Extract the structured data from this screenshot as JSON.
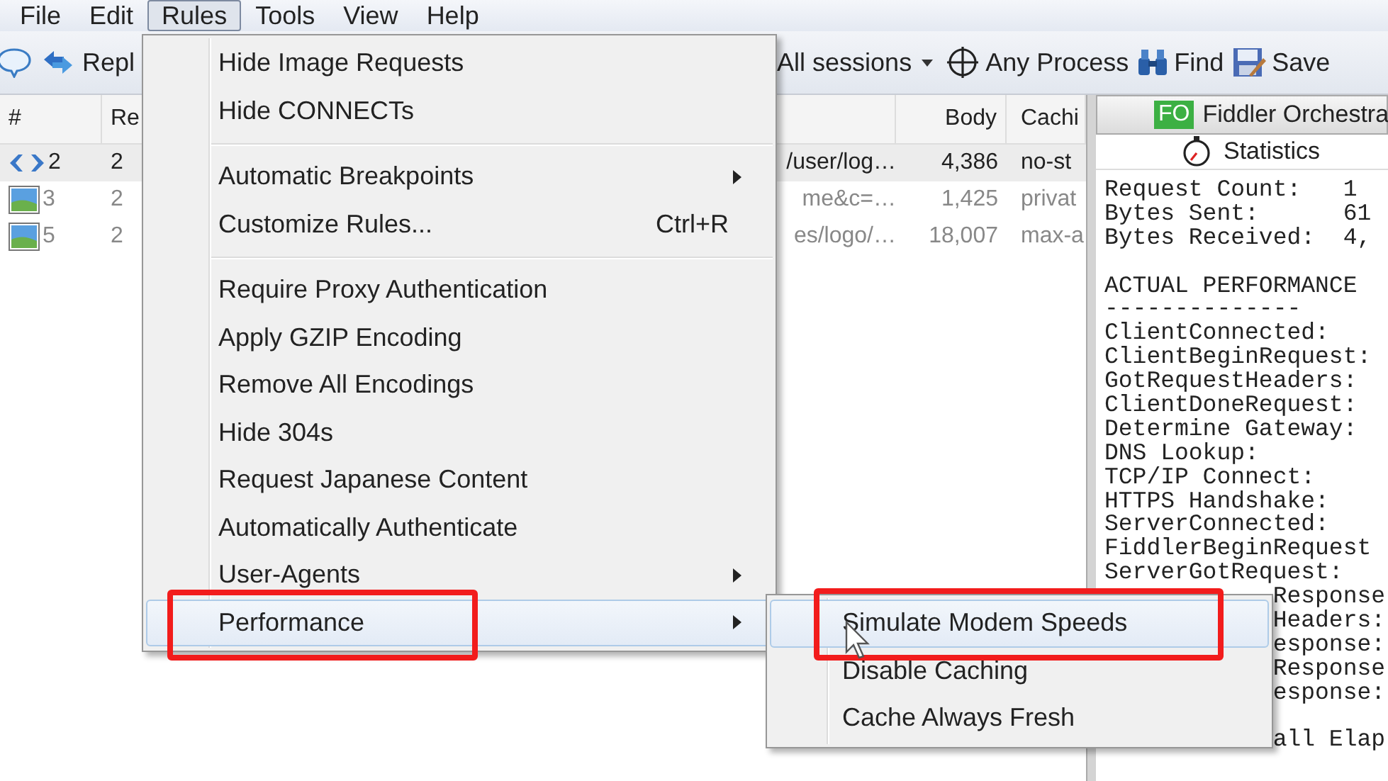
{
  "menubar": [
    {
      "label": "File",
      "selected": false
    },
    {
      "label": "Edit",
      "selected": false
    },
    {
      "label": "Rules",
      "selected": true
    },
    {
      "label": "Tools",
      "selected": false
    },
    {
      "label": "View",
      "selected": false
    },
    {
      "label": "Help",
      "selected": false
    }
  ],
  "toolbar": {
    "replay": "Repl",
    "sessions_filter": "All sessions",
    "process": "Any Process",
    "find": "Find",
    "save": "Save"
  },
  "sessions": {
    "columns": [
      "#",
      "Re",
      "Body",
      "Cachi"
    ],
    "rows": [
      {
        "kind": "code",
        "number": "2",
        "result": "2",
        "url": "/user/log…",
        "body": "4,386",
        "caching": "no-st",
        "selected": true
      },
      {
        "kind": "image",
        "number": "3",
        "result": "2",
        "url": "me&c=…",
        "body": "1,425",
        "caching": "privat",
        "selected": false
      },
      {
        "kind": "image",
        "number": "5",
        "result": "2",
        "url": "es/logo/…",
        "body": "18,007",
        "caching": "max-a",
        "selected": false
      }
    ]
  },
  "inspector": {
    "tab": {
      "badge": "FO",
      "label": "Fiddler Orchestra"
    },
    "statistics_tab": "Statistics",
    "lines": [
      {
        "kind": "text",
        "text": "Request Count:   1"
      },
      {
        "kind": "text",
        "text": "Bytes Sent:      61"
      },
      {
        "kind": "text",
        "text": "Bytes Received:  4,"
      },
      {
        "kind": "blank"
      },
      {
        "kind": "text",
        "text": "ACTUAL PERFORMANCE"
      },
      {
        "kind": "text",
        "text": "--------------"
      },
      {
        "kind": "text",
        "text": "ClientConnected:"
      },
      {
        "kind": "text",
        "text": "ClientBeginRequest:"
      },
      {
        "kind": "text",
        "text": "GotRequestHeaders:"
      },
      {
        "kind": "text",
        "text": "ClientDoneRequest:"
      },
      {
        "kind": "text",
        "text": "Determine Gateway:"
      },
      {
        "kind": "text",
        "text": "DNS Lookup:"
      },
      {
        "kind": "text",
        "text": "TCP/IP Connect:"
      },
      {
        "kind": "text",
        "text": "HTTPS Handshake:"
      },
      {
        "kind": "text",
        "text": "ServerConnected:"
      },
      {
        "kind": "text",
        "text": "FiddlerBeginRequest"
      },
      {
        "kind": "text",
        "text": "ServerGotRequest:"
      },
      {
        "kind": "partial",
        "text": "Response"
      },
      {
        "kind": "partial",
        "text": "Headers:"
      },
      {
        "kind": "partial",
        "text": "esponse:"
      },
      {
        "kind": "partial",
        "text": "Response"
      },
      {
        "kind": "partial",
        "text": "esponse:"
      },
      {
        "kind": "blank"
      },
      {
        "kind": "partial",
        "text": "all Elap"
      }
    ]
  },
  "rules_menu": {
    "items": [
      {
        "kind": "item",
        "label": "Hide Image Requests",
        "submenu": false,
        "selected": false,
        "annotated": false
      },
      {
        "kind": "item",
        "label": "Hide CONNECTs",
        "submenu": false,
        "selected": false,
        "annotated": false
      },
      {
        "kind": "separator"
      },
      {
        "kind": "item",
        "label": "Automatic Breakpoints",
        "submenu": true,
        "selected": false,
        "annotated": false
      },
      {
        "kind": "item",
        "label": "Customize Rules...",
        "shortcut": "Ctrl+R",
        "submenu": false,
        "selected": false,
        "annotated": false
      },
      {
        "kind": "separator"
      },
      {
        "kind": "item",
        "label": "Require Proxy Authentication",
        "submenu": false,
        "selected": false,
        "annotated": false
      },
      {
        "kind": "item",
        "label": "Apply GZIP Encoding",
        "submenu": false,
        "selected": false,
        "annotated": false
      },
      {
        "kind": "item",
        "label": "Remove All Encodings",
        "submenu": false,
        "selected": false,
        "annotated": false
      },
      {
        "kind": "item",
        "label": "Hide 304s",
        "submenu": false,
        "selected": false,
        "annotated": false
      },
      {
        "kind": "item",
        "label": "Request Japanese Content",
        "submenu": false,
        "selected": false,
        "annotated": false
      },
      {
        "kind": "item",
        "label": "Automatically Authenticate",
        "submenu": false,
        "selected": false,
        "annotated": false
      },
      {
        "kind": "item",
        "label": "User-Agents",
        "submenu": true,
        "selected": false,
        "annotated": false
      },
      {
        "kind": "item",
        "label": "Performance",
        "submenu": true,
        "selected": true,
        "annotated": true
      }
    ]
  },
  "performance_submenu": {
    "items": [
      {
        "kind": "item",
        "label": "Simulate Modem Speeds",
        "submenu": false,
        "selected": true,
        "annotated": true
      },
      {
        "kind": "item",
        "label": "Disable Caching",
        "submenu": false,
        "selected": false,
        "annotated": false
      },
      {
        "kind": "item",
        "label": "Cache Always Fresh",
        "submenu": false,
        "selected": false,
        "annotated": false
      }
    ]
  }
}
